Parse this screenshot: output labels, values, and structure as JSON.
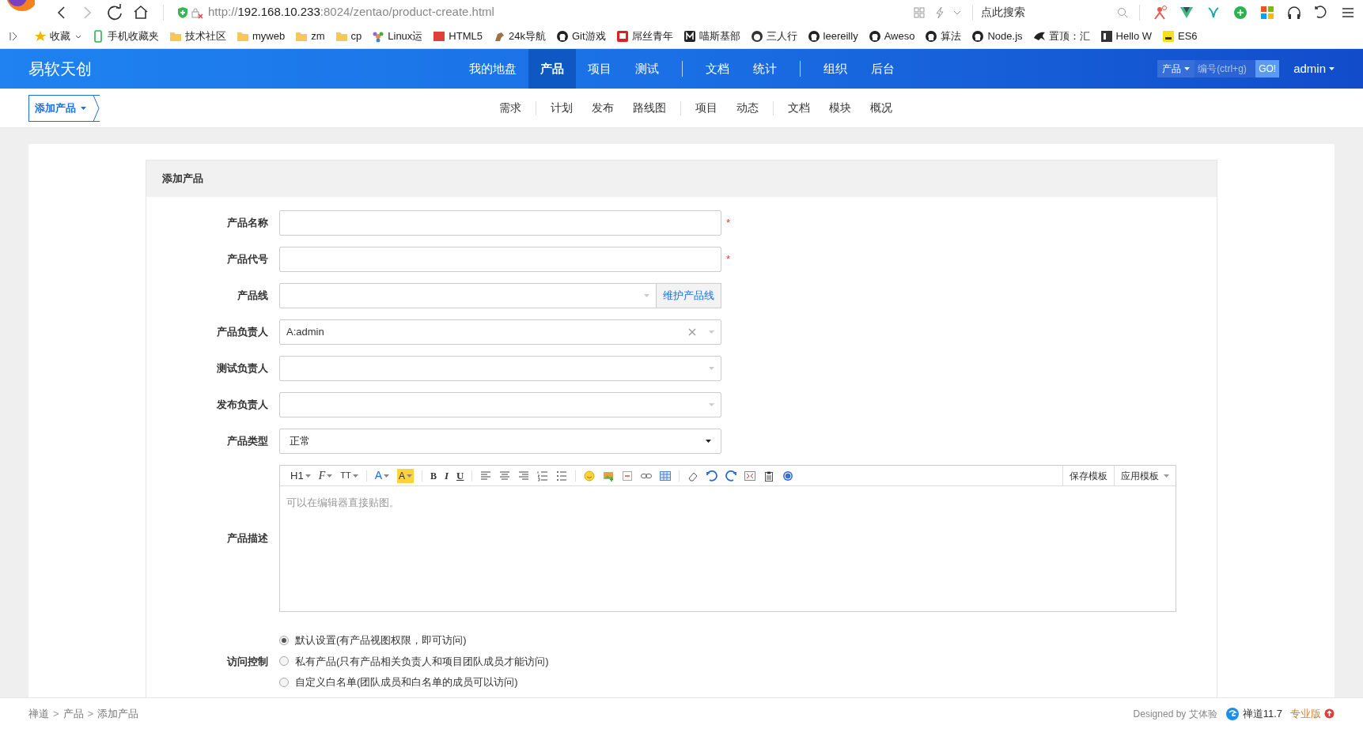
{
  "browser": {
    "url_host": "http://",
    "url_main": "192.168.10.233",
    "url_rest": ":8024/zentao/product-create.html",
    "search_placeholder": "点此搜索",
    "bookmarks": [
      {
        "label": "收藏",
        "dropdown": true
      },
      {
        "label": "手机收藏夹"
      },
      {
        "label": "技术社区"
      },
      {
        "label": "myweb"
      },
      {
        "label": "zm"
      },
      {
        "label": "cp"
      },
      {
        "label": "Linux运"
      },
      {
        "label": "HTML5"
      },
      {
        "label": "24k导航"
      },
      {
        "label": "Git游戏"
      },
      {
        "label": "屌丝青年"
      },
      {
        "label": "喵斯基部"
      },
      {
        "label": "三人行"
      },
      {
        "label": "leereilly"
      },
      {
        "label": "Aweso"
      },
      {
        "label": "算法"
      },
      {
        "label": "Node.js"
      },
      {
        "label": "置顶：汇"
      },
      {
        "label": "Hello W"
      },
      {
        "label": "ES6"
      }
    ]
  },
  "header": {
    "logo": "易软天创",
    "nav_groups": [
      [
        {
          "label": "我的地盘",
          "selected": false
        },
        {
          "label": "产品",
          "selected": true
        },
        {
          "label": "项目",
          "selected": false
        },
        {
          "label": "测试",
          "selected": false
        }
      ],
      [
        {
          "label": "文档",
          "selected": false
        },
        {
          "label": "统计",
          "selected": false
        }
      ],
      [
        {
          "label": "组织",
          "selected": false
        },
        {
          "label": "后台",
          "selected": false
        }
      ]
    ],
    "search_type": "产品",
    "search_placeholder": "编号(ctrl+g)",
    "go_button": "GO!",
    "user": "admin"
  },
  "subnav": {
    "add_button": "添加产品",
    "groups": [
      [
        "需求"
      ],
      [
        "计划",
        "发布",
        "路线图"
      ],
      [
        "项目",
        "动态"
      ],
      [
        "文档",
        "模块",
        "概况"
      ]
    ]
  },
  "form": {
    "title": "添加产品",
    "required_symbol": "*",
    "fields": [
      {
        "kind": "text",
        "label": "产品名称",
        "required": true
      },
      {
        "kind": "text",
        "label": "产品代号",
        "required": true
      },
      {
        "kind": "select_button",
        "label": "产品线",
        "button": "维护产品线"
      },
      {
        "kind": "picker",
        "label": "产品负责人",
        "value": "A:admin",
        "clearable": true
      },
      {
        "kind": "picker",
        "label": "测试负责人"
      },
      {
        "kind": "picker",
        "label": "发布负责人"
      },
      {
        "kind": "select",
        "label": "产品类型",
        "value": "正常"
      },
      {
        "kind": "editor",
        "label": "产品描述",
        "placeholder": "可以在编辑器直接贴图。",
        "text_buttons": [
          {
            "label": "H1",
            "dropdown": true
          },
          {
            "label": "F",
            "dropdown": true
          },
          {
            "label": "TT",
            "dropdown": true
          },
          {
            "label": "A",
            "dropdown": true
          },
          {
            "label": "A",
            "dropdown": true
          },
          {
            "label": "B"
          },
          {
            "label": "I"
          },
          {
            "label": "U"
          }
        ],
        "template_buttons": [
          {
            "label": "保存模板"
          },
          {
            "label": "应用模板",
            "dropdown": true
          }
        ]
      },
      {
        "kind": "radios",
        "label": "访问控制",
        "options": [
          {
            "label": "默认设置(有产品视图权限，即可访问)",
            "selected": true
          },
          {
            "label": "私有产品(只有产品相关负责人和项目团队成员才能访问)",
            "selected": false
          },
          {
            "label": "自定义白名单(团队成员和白名单的成员可以访问)",
            "selected": false
          }
        ]
      }
    ]
  },
  "footer": {
    "breadcrumb": [
      "禅道",
      "产品",
      "添加产品"
    ],
    "separator": ">",
    "designed_by": "Designed by 艾体验",
    "version": "禅道11.7",
    "edition": "专业版"
  }
}
